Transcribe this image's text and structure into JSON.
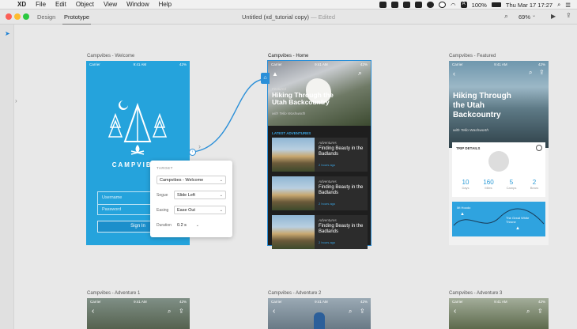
{
  "menubar": {
    "app_name": "XD",
    "items": [
      "File",
      "Edit",
      "Object",
      "View",
      "Window",
      "Help"
    ],
    "battery": "100%",
    "clock": "Thu Mar 17  17:27"
  },
  "toolbar": {
    "tabs": [
      "Design",
      "Prototype"
    ],
    "active_tab": "Prototype",
    "doc_title": "Untitled (xd_tutorial copy)",
    "doc_status": "— Edited",
    "zoom": "69%"
  },
  "artboards": {
    "welcome": {
      "label": "Campvibes - Welcome",
      "carrier": "Carrier",
      "time": "9:41 AM",
      "battery": "42%",
      "brand": "CAMPVIBES",
      "username_placeholder": "Username",
      "password_placeholder": "Password",
      "signin": "Sign In"
    },
    "home": {
      "label": "Campvibes - Home",
      "carrier": "Carrier",
      "time": "9:41 AM",
      "battery": "42%",
      "featured_tag": "Featured",
      "hero_title": "Hiking Through the Utah Backcountry",
      "hero_author": "with Tello Washworth",
      "section": "LATEST ADVENTURES",
      "items": [
        {
          "tag": "Adventures",
          "title": "Finding Beauty in the Badlands",
          "time": "2 hours ago"
        },
        {
          "tag": "Adventures",
          "title": "Finding Beauty in the Badlands",
          "time": "2 hours ago"
        },
        {
          "tag": "Adventures",
          "title": "Finding Beauty in the Badlands",
          "time": "2 hours ago"
        }
      ]
    },
    "featured": {
      "label": "Campvibes - Featured",
      "carrier": "Carrier",
      "time": "9:41 AM",
      "battery": "42%",
      "title": "Hiking Through the Utah Backcountry",
      "author": "with Tello Washworth",
      "trip_details": "TRIP DETAILS",
      "stats": [
        {
          "n": "10",
          "l": "Days"
        },
        {
          "n": "160",
          "l": "Miles"
        },
        {
          "n": "5",
          "l": "Camps"
        },
        {
          "n": "2",
          "l": "Bears"
        }
      ],
      "map_label_1": "Mt Hoodo",
      "map_label_2": "The Great White Throne"
    },
    "adventure1": {
      "label": "Campvibes - Adventure 1",
      "carrier": "Carrier",
      "time": "9:41 AM",
      "battery": "42%"
    },
    "adventure2": {
      "label": "Campvibes - Adventure 2",
      "carrier": "Carrier",
      "time": "9:41 AM",
      "battery": "42%"
    },
    "adventure3": {
      "label": "Campvibes - Adventure 3",
      "carrier": "Carrier",
      "time": "9:41 AM",
      "battery": "42%"
    }
  },
  "popup": {
    "heading": "TARGET",
    "target": "Campvibes - Welcome",
    "segue_label": "Segue",
    "segue": "Slide Left",
    "easing_label": "Easing",
    "easing": "Ease Out",
    "duration_label": "Duration",
    "duration": "0.2 s"
  },
  "colors": {
    "welcome_blue": "#25a3dc",
    "link_blue": "#2a8fd8",
    "dark_card": "#2c2c2c"
  }
}
